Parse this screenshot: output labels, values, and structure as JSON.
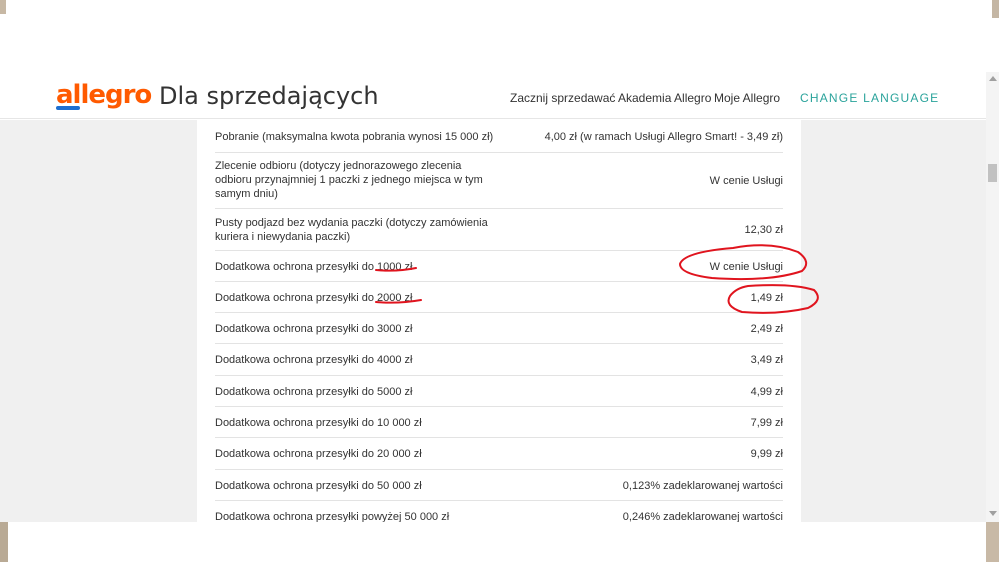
{
  "header": {
    "logo_text": "allegro",
    "site_title": "Dla sprzedających",
    "nav": [
      "Zacznij sprzedawać",
      "Akademia Allegro",
      "Moje Allegro"
    ],
    "change_language": "CHANGE LANGUAGE"
  },
  "pricing": {
    "rows": [
      {
        "label": "Pobranie (maksymalna kwota pobrania wynosi 15 000 zł)",
        "value": "4,00 zł (w ramach Usługi Allegro Smart! - 3,49 zł)"
      },
      {
        "label": "Zlecenie odbioru (dotyczy jednorazowego zlecenia odbioru przynajmniej 1 paczki z jednego miejsca w tym samym dniu)",
        "value": "W cenie Usługi"
      },
      {
        "label": "Pusty podjazd bez wydania paczki (dotyczy zamówienia kuriera i niewydania paczki)",
        "value": "12,30 zł"
      },
      {
        "label": "Dodatkowa ochrona przesyłki do 1000 zł",
        "value": "W cenie Usługi"
      },
      {
        "label": "Dodatkowa ochrona przesyłki do 2000 zł",
        "value": "1,49 zł"
      },
      {
        "label": "Dodatkowa ochrona przesyłki do 3000 zł",
        "value": "2,49 zł"
      },
      {
        "label": "Dodatkowa ochrona przesyłki do 4000 zł",
        "value": "3,49 zł"
      },
      {
        "label": "Dodatkowa ochrona przesyłki do 5000 zł",
        "value": "4,99 zł"
      },
      {
        "label": "Dodatkowa ochrona przesyłki do 10 000 zł",
        "value": "7,99 zł"
      },
      {
        "label": "Dodatkowa ochrona przesyłki do 20 000 zł",
        "value": "9,99 zł"
      },
      {
        "label": "Dodatkowa ochrona przesyłki do 50 000 zł",
        "value": "0,123% zadeklarowanej wartości"
      },
      {
        "label": "Dodatkowa ochrona przesyłki powyżej 50 000 zł",
        "value": "0,246% zadeklarowanej wartości"
      }
    ]
  },
  "colors": {
    "accent_teal": "#2aa39b",
    "annotation_red": "#e0141e",
    "logo_orange": "#ff5a00"
  }
}
